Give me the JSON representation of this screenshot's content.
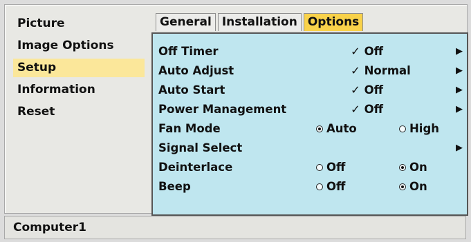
{
  "sidebar": {
    "items": [
      {
        "label": "Picture"
      },
      {
        "label": "Image Options"
      },
      {
        "label": "Setup"
      },
      {
        "label": "Information"
      },
      {
        "label": "Reset"
      }
    ],
    "active": "Setup"
  },
  "tabs": [
    {
      "label": "General"
    },
    {
      "label": "Installation"
    },
    {
      "label": "Options"
    }
  ],
  "active_tab": "Options",
  "options": {
    "off_timer": {
      "label": "Off Timer",
      "value": "✓ Off"
    },
    "auto_adjust": {
      "label": "Auto Adjust",
      "value": "✓ Normal"
    },
    "auto_start": {
      "label": "Auto Start",
      "value": "✓ Off"
    },
    "power_management": {
      "label": "Power Management",
      "value": "✓ Off"
    },
    "fan_mode": {
      "label": "Fan Mode",
      "opt1": "Auto",
      "opt2": "High",
      "selected": "Auto"
    },
    "signal_select": {
      "label": "Signal Select"
    },
    "deinterlace": {
      "label": "Deinterlace",
      "opt1": "Off",
      "opt2": "On",
      "selected": "On"
    },
    "beep": {
      "label": "Beep",
      "opt1": "Off",
      "opt2": "On",
      "selected": "On"
    },
    "arrow": "▶"
  },
  "status": {
    "source": "Computer1"
  },
  "colors": {
    "panel": "#bfe6ef",
    "active_tab": "#f9d24a",
    "active_sidebar": "#fbe79a"
  }
}
